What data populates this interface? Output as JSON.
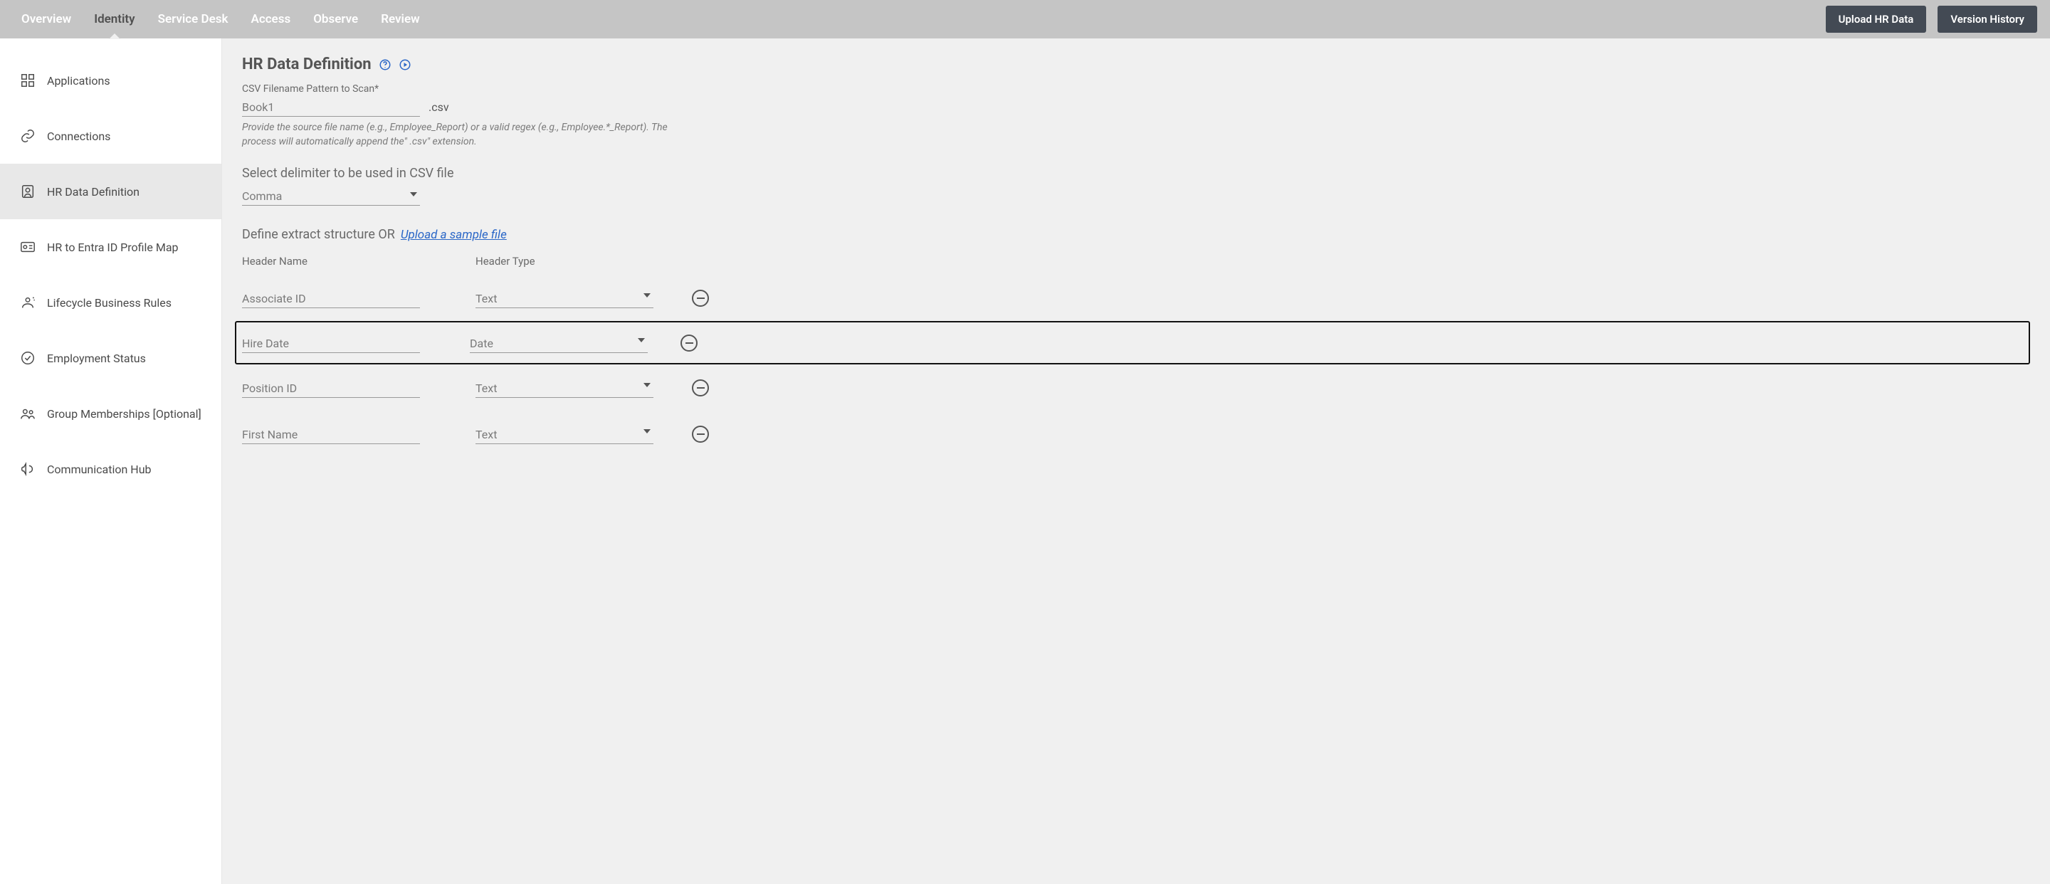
{
  "topbar": {
    "tabs": [
      {
        "label": "Overview"
      },
      {
        "label": "Identity"
      },
      {
        "label": "Service Desk"
      },
      {
        "label": "Access"
      },
      {
        "label": "Observe"
      },
      {
        "label": "Review"
      }
    ],
    "active_index": 1,
    "actions": {
      "upload": "Upload HR Data",
      "version": "Version History"
    }
  },
  "sidebar": {
    "items": [
      {
        "label": "Applications",
        "icon": "grid"
      },
      {
        "label": "Connections",
        "icon": "link"
      },
      {
        "label": "HR Data Definition",
        "icon": "id-badge"
      },
      {
        "label": "HR to Entra ID Profile Map",
        "icon": "id-card"
      },
      {
        "label": "Lifecycle Business Rules",
        "icon": "user-cycle"
      },
      {
        "label": "Employment Status",
        "icon": "check-circle"
      },
      {
        "label": "Group Memberships [Optional]",
        "icon": "users"
      },
      {
        "label": "Communication Hub",
        "icon": "megaphone"
      }
    ],
    "active_index": 2
  },
  "main": {
    "title": "HR Data Definition",
    "filename_label": "CSV Filename Pattern to Scan*",
    "filename_value": "Book1",
    "filename_ext": ".csv",
    "filename_hint": "Provide the source file name (e.g., Employee_Report) or a valid regex (e.g., Employee.*_Report). The process will automatically append the\" .csv\" extension.",
    "delimiter_label": "Select delimiter to be used in CSV file",
    "delimiter_value": "Comma",
    "define_label": "Define extract structure OR",
    "upload_sample_link": "Upload a sample file",
    "col_headers": {
      "name": "Header Name",
      "type": "Header Type"
    },
    "rows": [
      {
        "name": "Associate ID",
        "type": "Text",
        "highlight": false
      },
      {
        "name": "Hire Date",
        "type": "Date",
        "highlight": true
      },
      {
        "name": "Position ID",
        "type": "Text",
        "highlight": false
      },
      {
        "name": "First Name",
        "type": "Text",
        "highlight": false
      }
    ]
  }
}
